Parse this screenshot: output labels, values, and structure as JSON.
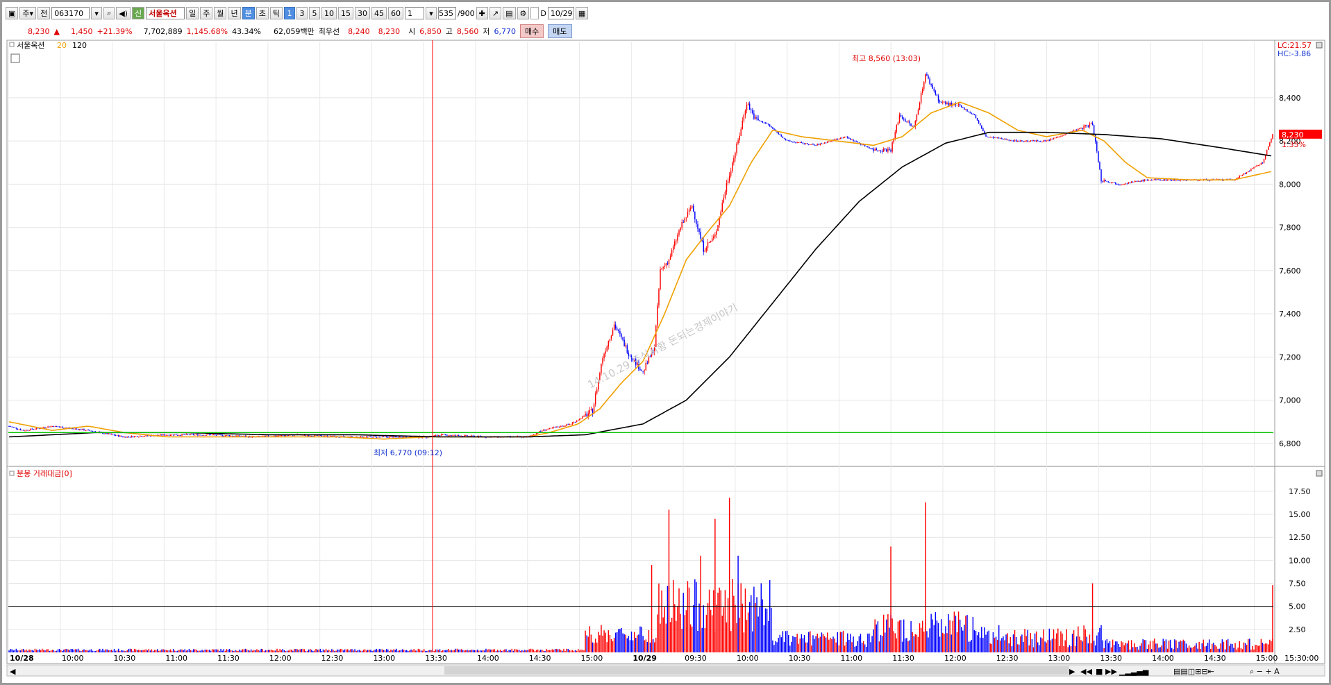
{
  "toolbar": {
    "mode_label": "주",
    "jeon_label": "전",
    "code": "063170",
    "sin_label": "신",
    "stock_name": "서울옥션",
    "period_buttons": [
      "일",
      "주",
      "월",
      "년"
    ],
    "unit_buttons": [
      "분",
      "초",
      "틱"
    ],
    "interval_buttons": [
      "1",
      "3",
      "5",
      "10",
      "15",
      "30",
      "45",
      "60"
    ],
    "interval_value": "1",
    "count": "535",
    "count_total": "/900",
    "date": "10/29",
    "checkbox_d": "D"
  },
  "quote": {
    "price": "8,230",
    "arrow": "▲",
    "change": "1,450",
    "change_pct": "+21.39%",
    "volume": "7,702,889",
    "volume_ratio": "1,145.68%",
    "turnover": "43.34%",
    "amount": "62,059백만",
    "best_label": "최우선",
    "best_ask": "8,240",
    "best_bid": "8,230",
    "open_label": "시",
    "open": "6,850",
    "high_label": "고",
    "high": "8,560",
    "low_label": "저",
    "low": "6,770",
    "buy_label": "매수",
    "sell_label": "매도"
  },
  "colors": {
    "up": "#ff0000",
    "down": "#0000ff",
    "ma20": "#f0a000",
    "ma120": "#000000",
    "hline": "#00c000",
    "cursor": "#ff0000"
  },
  "chart_data": [
    {
      "type": "candlestick",
      "legend": {
        "name": "서울옥션",
        "ma1": "20",
        "ma2": "120"
      },
      "corner_labels": {
        "lc": "LC:21.57",
        "hc": "HC:-3.86"
      },
      "current_price_label": "8,230",
      "current_pct_label": "1.35%",
      "ylim": [
        6700,
        8660
      ],
      "y_ticks": [
        "8,400",
        "8,200",
        "8,000",
        "7,800",
        "7,600",
        "7,400",
        "7,200",
        "7,000",
        "6,800"
      ],
      "y_tick_values": [
        8400,
        8200,
        8000,
        7800,
        7600,
        7400,
        7200,
        7000,
        6800
      ],
      "hline_value": 6850,
      "x_ticks": [
        "10/28",
        "10:00",
        "10:30",
        "11:00",
        "11:30",
        "12:00",
        "12:30",
        "13:00",
        "13:30",
        "14:00",
        "14:30",
        "15:00",
        "10/29",
        "09:30",
        "10:00",
        "10:30",
        "11:00",
        "11:30",
        "12:00",
        "12:30",
        "13:00",
        "13:30",
        "14:00",
        "14:30",
        "15:00",
        "15:30:00"
      ],
      "high_annotation": "최고 8,560 (13:03)",
      "low_annotation": "최저 6,770 (09:12)",
      "watermark": "14.10.29 주식시황 돈되는경제이야기",
      "price_path_knots": [
        [
          0,
          6880
        ],
        [
          10,
          6860
        ],
        [
          30,
          6880
        ],
        [
          55,
          6860
        ],
        [
          80,
          6830
        ],
        [
          110,
          6840
        ],
        [
          140,
          6840
        ],
        [
          170,
          6830
        ],
        [
          200,
          6840
        ],
        [
          230,
          6830
        ],
        [
          260,
          6830
        ],
        [
          290,
          6830
        ],
        [
          300,
          6840
        ],
        [
          330,
          6830
        ],
        [
          360,
          6830
        ],
        [
          370,
          6860
        ],
        [
          390,
          6890
        ],
        [
          405,
          6950
        ],
        [
          412,
          7200
        ],
        [
          420,
          7350
        ],
        [
          430,
          7220
        ],
        [
          440,
          7130
        ],
        [
          448,
          7250
        ],
        [
          452,
          7600
        ],
        [
          458,
          7650
        ],
        [
          466,
          7800
        ],
        [
          474,
          7900
        ],
        [
          482,
          7700
        ],
        [
          490,
          7760
        ],
        [
          498,
          8000
        ],
        [
          506,
          8200
        ],
        [
          512,
          8380
        ],
        [
          518,
          8300
        ],
        [
          526,
          8280
        ],
        [
          540,
          8200
        ],
        [
          560,
          8180
        ],
        [
          580,
          8220
        ],
        [
          600,
          8160
        ],
        [
          612,
          8160
        ],
        [
          618,
          8320
        ],
        [
          628,
          8260
        ],
        [
          636,
          8510
        ],
        [
          646,
          8380
        ],
        [
          660,
          8360
        ],
        [
          670,
          8320
        ],
        [
          678,
          8220
        ],
        [
          700,
          8200
        ],
        [
          720,
          8200
        ],
        [
          740,
          8250
        ],
        [
          752,
          8280
        ],
        [
          758,
          8020
        ],
        [
          770,
          8000
        ],
        [
          790,
          8020
        ],
        [
          820,
          8020
        ],
        [
          850,
          8020
        ],
        [
          870,
          8100
        ],
        [
          877,
          8230
        ]
      ],
      "ma20_knots": [
        [
          0,
          6900
        ],
        [
          30,
          6860
        ],
        [
          55,
          6880
        ],
        [
          80,
          6850
        ],
        [
          110,
          6830
        ],
        [
          140,
          6830
        ],
        [
          170,
          6830
        ],
        [
          200,
          6830
        ],
        [
          230,
          6830
        ],
        [
          260,
          6820
        ],
        [
          290,
          6830
        ],
        [
          330,
          6830
        ],
        [
          360,
          6830
        ],
        [
          375,
          6850
        ],
        [
          395,
          6890
        ],
        [
          410,
          6960
        ],
        [
          425,
          7080
        ],
        [
          440,
          7180
        ],
        [
          455,
          7400
        ],
        [
          470,
          7650
        ],
        [
          485,
          7780
        ],
        [
          500,
          7900
        ],
        [
          515,
          8100
        ],
        [
          530,
          8250
        ],
        [
          550,
          8220
        ],
        [
          575,
          8200
        ],
        [
          600,
          8180
        ],
        [
          620,
          8220
        ],
        [
          640,
          8330
        ],
        [
          660,
          8380
        ],
        [
          680,
          8330
        ],
        [
          700,
          8250
        ],
        [
          720,
          8220
        ],
        [
          745,
          8250
        ],
        [
          760,
          8200
        ],
        [
          775,
          8100
        ],
        [
          790,
          8030
        ],
        [
          820,
          8020
        ],
        [
          850,
          8020
        ],
        [
          877,
          8060
        ]
      ],
      "ma120_knots": [
        [
          0,
          6830
        ],
        [
          60,
          6850
        ],
        [
          120,
          6850
        ],
        [
          180,
          6840
        ],
        [
          240,
          6840
        ],
        [
          300,
          6830
        ],
        [
          360,
          6830
        ],
        [
          400,
          6840
        ],
        [
          440,
          6890
        ],
        [
          470,
          7000
        ],
        [
          500,
          7200
        ],
        [
          530,
          7450
        ],
        [
          560,
          7700
        ],
        [
          590,
          7920
        ],
        [
          620,
          8080
        ],
        [
          650,
          8190
        ],
        [
          680,
          8240
        ],
        [
          720,
          8240
        ],
        [
          760,
          8230
        ],
        [
          800,
          8210
        ],
        [
          840,
          8170
        ],
        [
          877,
          8130
        ]
      ]
    },
    {
      "type": "bar",
      "legend": "분봉 거래대금[0]",
      "ylim": [
        0,
        19
      ],
      "y_ticks": [
        "17.50",
        "15.00",
        "12.50",
        "10.00",
        "7.50",
        "5.00",
        "2.50"
      ],
      "y_tick_values": [
        17.5,
        15,
        12.5,
        10,
        7.5,
        5,
        2.5
      ],
      "hline_value": 5.0,
      "peak_bars": [
        {
          "x": 446,
          "value": 9.5,
          "color": "up"
        },
        {
          "x": 458,
          "value": 15.5,
          "color": "up"
        },
        {
          "x": 480,
          "value": 10.5,
          "color": "up"
        },
        {
          "x": 490,
          "value": 14.5,
          "color": "up"
        },
        {
          "x": 500,
          "value": 16.8,
          "color": "up"
        },
        {
          "x": 506,
          "value": 10.5,
          "color": "down"
        },
        {
          "x": 636,
          "value": 16.3,
          "color": "up"
        },
        {
          "x": 612,
          "value": 11.5,
          "color": "up"
        },
        {
          "x": 752,
          "value": 7.5,
          "color": "up"
        },
        {
          "x": 877,
          "value": 7.3,
          "color": "up"
        }
      ]
    }
  ]
}
